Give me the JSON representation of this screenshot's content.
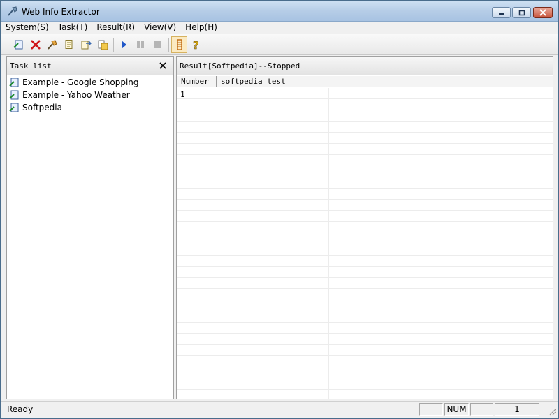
{
  "window": {
    "title": "Web Info Extractor",
    "icon": "app-icon"
  },
  "menu": {
    "items": [
      "System(S)",
      "Task(T)",
      "Result(R)",
      "View(V)",
      "Help(H)"
    ]
  },
  "toolbar": {
    "buttons": [
      {
        "icon": "new-task-icon"
      },
      {
        "icon": "delete-icon"
      },
      {
        "icon": "edit-task-icon"
      },
      {
        "icon": "copy-icon"
      },
      {
        "icon": "export-icon"
      },
      {
        "icon": "import-icon"
      },
      {
        "icon": "play-icon"
      },
      {
        "icon": "pause-icon"
      },
      {
        "icon": "stop-icon"
      },
      {
        "icon": "result-icon"
      },
      {
        "icon": "help-icon"
      }
    ]
  },
  "task_panel": {
    "title": "Task list",
    "items": [
      {
        "label": "Example - Google Shopping"
      },
      {
        "label": "Example - Yahoo Weather"
      },
      {
        "label": "Softpedia"
      }
    ]
  },
  "result_panel": {
    "title": "Result[Softpedia]--Stopped",
    "columns": [
      "Number",
      "softpedia test"
    ],
    "rows": [
      [
        "1",
        ""
      ]
    ]
  },
  "status": {
    "text": "Ready",
    "num": "NUM",
    "count": "1"
  },
  "colors": {
    "accent": "#6fa3cf",
    "title_bar": "#b6cde7",
    "close_button": "#c8553d",
    "active_toolbar": "#fbeac2"
  }
}
